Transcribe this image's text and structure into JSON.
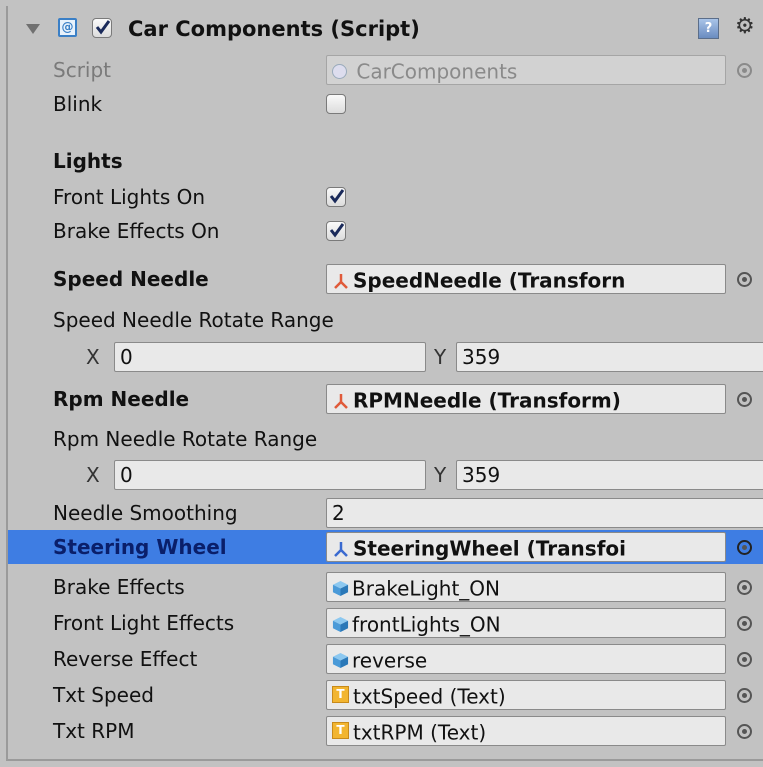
{
  "header": {
    "title": "Car Components (Script)",
    "enabled": true,
    "icons": [
      "foldout-arrow-icon",
      "script-icon",
      "help-icon",
      "gear-icon"
    ]
  },
  "script": {
    "label": "Script",
    "value": "CarComponents"
  },
  "blink": {
    "label": "Blink",
    "checked": false
  },
  "lights_header": "Lights",
  "front_lights_on": {
    "label": "Front Lights On",
    "checked": true
  },
  "brake_effects_on": {
    "label": "Brake Effects On",
    "checked": true
  },
  "speed_needle": {
    "label": "Speed Needle",
    "value": "SpeedNeedle (Transforn"
  },
  "speed_needle_range": {
    "label": "Speed Needle Rotate Range",
    "x_label": "X",
    "x": "0",
    "y_label": "Y",
    "y": "359"
  },
  "rpm_needle": {
    "label": "Rpm Needle",
    "value": "RPMNeedle (Transform)"
  },
  "rpm_needle_range": {
    "label": "Rpm Needle Rotate Range",
    "x_label": "X",
    "x": "0",
    "y_label": "Y",
    "y": "359"
  },
  "needle_smoothing": {
    "label": "Needle Smoothing",
    "value": "2"
  },
  "steering_wheel": {
    "label": "Steering Wheel",
    "value": "SteeringWheel (Transfoi",
    "selected": true
  },
  "brake_effects": {
    "label": "Brake Effects",
    "value": "BrakeLight_ON"
  },
  "front_light_effects": {
    "label": "Front Light Effects",
    "value": "frontLights_ON"
  },
  "reverse_effect": {
    "label": "Reverse Effect",
    "value": "reverse"
  },
  "txt_speed": {
    "label": "Txt Speed",
    "value": "txtSpeed (Text)"
  },
  "txt_rpm": {
    "label": "Txt RPM",
    "value": "txtRPM (Text)"
  },
  "colors": {
    "background": "#c2c2c2",
    "selection": "#3e7de3",
    "field": "#e9e9e9",
    "checkbox_check": "#1a2a5a"
  }
}
